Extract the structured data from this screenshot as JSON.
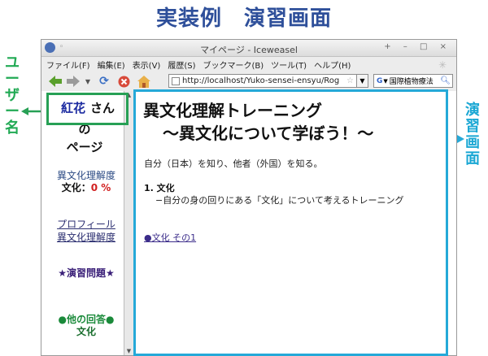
{
  "slide": {
    "title": "実装例　演習画面",
    "user_label": "ユーザー名",
    "area_label": "演習画面"
  },
  "window": {
    "title": "マイページ - Iceweasel",
    "controls": "+ – □ ×",
    "menu": [
      "ファイル(F)",
      "編集(E)",
      "表示(V)",
      "履歴(S)",
      "ブックマーク(B)",
      "ツール(T)",
      "ヘルプ(H)"
    ],
    "url": "http://localhost/Yuko-sensei-ensyu/Rog",
    "search_engine": "G",
    "search_text": "国際植物療法"
  },
  "icons": {
    "back": "back-arrow-icon",
    "forward": "forward-arrow-icon",
    "reload": "reload-icon",
    "stop": "stop-icon",
    "home": "home-icon",
    "search": "magnifier-icon"
  },
  "sidebar": {
    "user_name": "紅花",
    "honorific": "さん",
    "no": "の",
    "page": "ページ",
    "understanding_label": "異文化理解度",
    "score_prefix": "文化：",
    "score_value": "0 %",
    "profile_link_line1": "プロフィール",
    "profile_link_line2": "異文化理解度",
    "exercise": "★演習問題★",
    "other_answers": "●他の回答●",
    "other_answers_sub": "文化"
  },
  "content": {
    "heading1": "異文化理解トレーニング",
    "heading2": "～異文化について学ぼう！～",
    "intro": "自分（日本）を知り、他者（外国）を知る。",
    "section_title": "1. 文化",
    "section_body": "−自分の身の回りにある「文化」について考えるトレーニング",
    "link_text": "●文化 その1"
  },
  "colors": {
    "title_blue": "#2e4f9a",
    "highlight_green": "#27a055",
    "highlight_blue": "#25a9d8",
    "score_red": "#d12020"
  }
}
